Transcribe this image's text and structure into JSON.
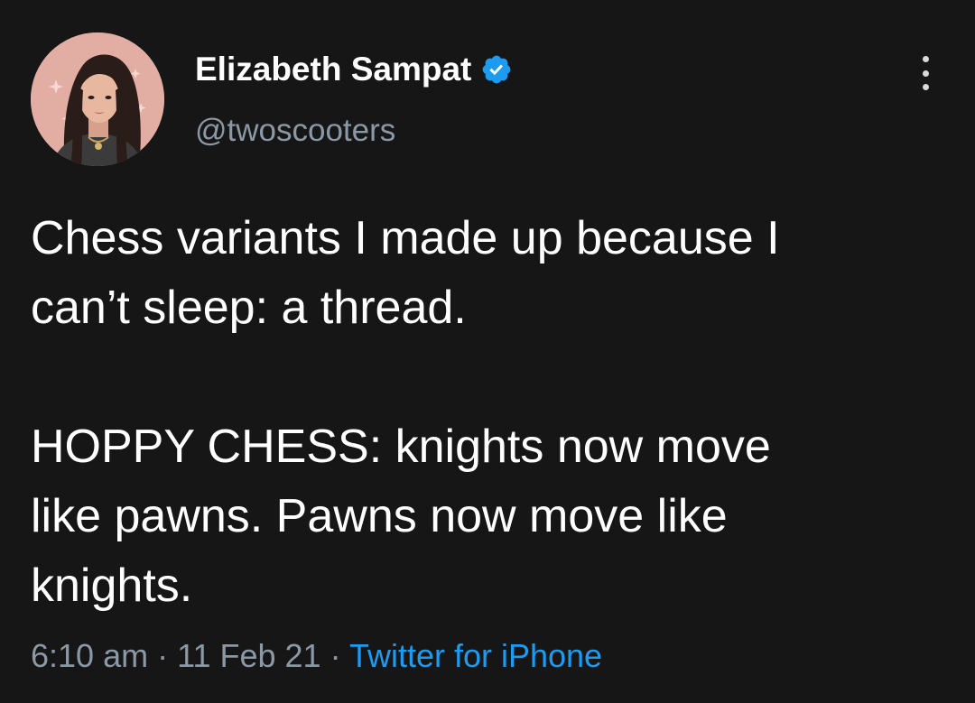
{
  "author": {
    "display_name": "Elizabeth Sampat",
    "handle": "@twoscooters",
    "verified": true
  },
  "tweet": {
    "text": "Chess variants I made up because I\ncan’t sleep: a thread.\n\nHOPPY CHESS: knights now move\nlike pawns. Pawns now move like\nknights.",
    "time": "6:10 am",
    "separator": "·",
    "date": "11 Feb 21",
    "source": "Twitter for iPhone"
  },
  "icons": {
    "verified": "verified-badge-icon",
    "more": "more-vertical-icon"
  },
  "colors": {
    "background": "#161616",
    "text": "#ffffff",
    "secondary_text": "#8b98a5",
    "link": "#1d9bf0",
    "verified": "#1d9bf0"
  }
}
